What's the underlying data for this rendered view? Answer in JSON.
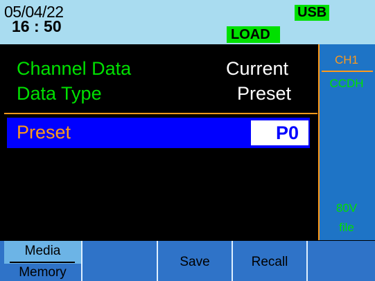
{
  "status": {
    "date": "05/04/22",
    "time": "16 : 50",
    "usb_badge": "USB",
    "load_badge": "LOAD"
  },
  "main": {
    "channel_data_label": "Channel Data",
    "channel_data_value": "Current",
    "data_type_label": "Data Type",
    "data_type_value": "Preset",
    "preset_label": "Preset",
    "preset_value": "P0"
  },
  "sidebar": {
    "channel": "CH1",
    "mode": "CCDH",
    "voltage": "80V",
    "file": "file"
  },
  "softkeys": {
    "media_label": "Media",
    "memory_label": "Memory",
    "save_label": "Save",
    "recall_label": "Recall"
  },
  "colors": {
    "status_bar": "#a9dcf0",
    "badge_green": "#00e000",
    "label_green": "#00e000",
    "accent_orange": "#ff9a1a",
    "highlight_blue": "#0000ff",
    "sidebar_blue": "#1e74c6",
    "softkey_blue": "#2f73c8"
  }
}
